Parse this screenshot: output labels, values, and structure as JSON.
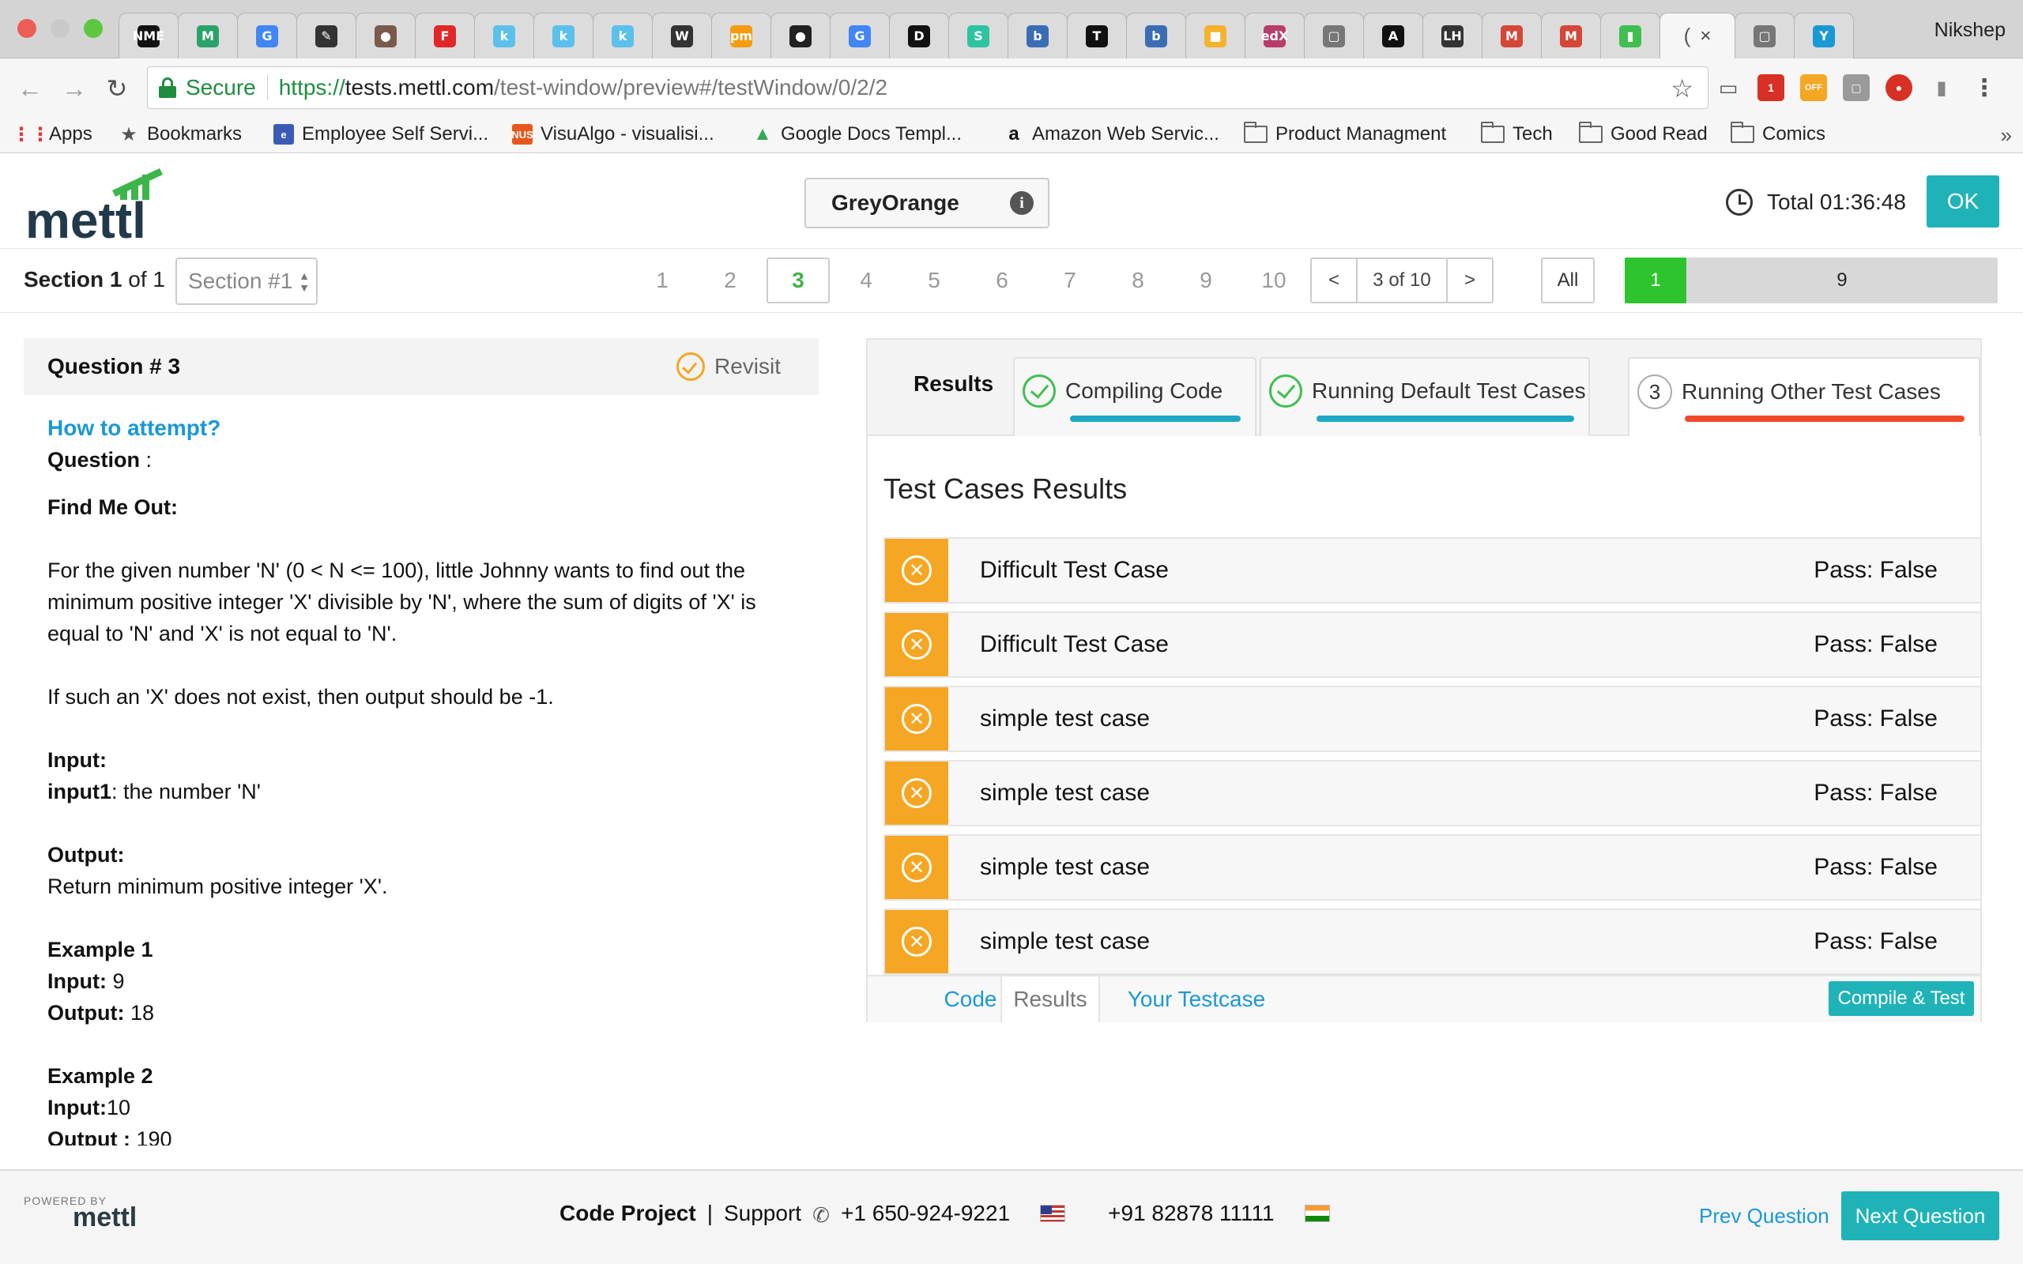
{
  "browser": {
    "profile_name": "Nikshep",
    "tabs": [
      {
        "icon": "nme-icon",
        "glyph": "NME",
        "color": "#111111"
      },
      {
        "icon": "m-logo-icon",
        "glyph": "M",
        "color": "#2aa36b"
      },
      {
        "icon": "google-icon",
        "glyph": "G",
        "color": "#4285f4"
      },
      {
        "icon": "pin-icon",
        "glyph": "✎",
        "color": "#333333"
      },
      {
        "icon": "avatar-icon",
        "glyph": "●",
        "color": "#7a5a4a"
      },
      {
        "icon": "flipboard-icon",
        "glyph": "F",
        "color": "#e12828"
      },
      {
        "icon": "k-icon",
        "glyph": "k",
        "color": "#5bc0eb"
      },
      {
        "icon": "k-icon",
        "glyph": "k",
        "color": "#5bc0eb"
      },
      {
        "icon": "k-icon",
        "glyph": "k",
        "color": "#5bc0eb"
      },
      {
        "icon": "wikipedia-icon",
        "glyph": "W",
        "color": "#333333"
      },
      {
        "icon": "pm-icon",
        "glyph": "pm",
        "color": "#f39c12"
      },
      {
        "icon": "github-icon",
        "glyph": "●",
        "color": "#222222"
      },
      {
        "icon": "google-icon",
        "glyph": "G",
        "color": "#4285f4"
      },
      {
        "icon": "d-icon",
        "glyph": "D",
        "color": "#111111"
      },
      {
        "icon": "s-icon",
        "glyph": "S",
        "color": "#2ec4a0"
      },
      {
        "icon": "b-icon",
        "glyph": "b",
        "color": "#3a6db4"
      },
      {
        "icon": "nyt-icon",
        "glyph": "T",
        "color": "#111111"
      },
      {
        "icon": "b-icon",
        "glyph": "b",
        "color": "#3a6db4"
      },
      {
        "icon": "box-icon",
        "glyph": "■",
        "color": "#f5b22d"
      },
      {
        "icon": "edx-icon",
        "glyph": "edX",
        "color": "#b83c6a"
      },
      {
        "icon": "document-icon",
        "glyph": "▢",
        "color": "#777777"
      },
      {
        "icon": "a-icon",
        "glyph": "A",
        "color": "#111111"
      },
      {
        "icon": "lh-icon",
        "glyph": "LH",
        "color": "#333333"
      },
      {
        "icon": "gmail-icon",
        "glyph": "M",
        "color": "#d44638"
      },
      {
        "icon": "gmail-icon",
        "glyph": "M",
        "color": "#d44638"
      },
      {
        "icon": "chart-icon",
        "glyph": "▮",
        "color": "#3fbf4f"
      }
    ],
    "active_tab_glyph": "(",
    "active_tab_close": "×",
    "trailing_tabs": [
      {
        "icon": "document-icon",
        "glyph": "▢",
        "color": "#777777"
      },
      {
        "icon": "y-icon",
        "glyph": "Y",
        "color": "#1a98d5"
      }
    ],
    "secure_label": "Secure",
    "url_scheme": "https://",
    "url_host": "tests.mettl.com",
    "url_path": "/test-window/preview#/testWindow/0/2/2",
    "bookmarks": [
      {
        "label": "Apps",
        "icon": "apps-icon"
      },
      {
        "label": "Bookmarks",
        "icon": "star-icon"
      },
      {
        "label": "Employee Self Servi...",
        "icon": "ess-icon"
      },
      {
        "label": "VisuAlgo - visualisi...",
        "icon": "nus-icon"
      },
      {
        "label": "Google Docs Templ...",
        "icon": "drive-icon"
      },
      {
        "label": "Amazon Web Servic...",
        "icon": "amazon-icon"
      },
      {
        "label": "Product Managment",
        "icon": "folder-icon"
      },
      {
        "label": "Tech",
        "icon": "folder-icon"
      },
      {
        "label": "Good Read",
        "icon": "folder-icon"
      },
      {
        "label": "Comics",
        "icon": "folder-icon"
      }
    ],
    "bookmarks_more": "»"
  },
  "header": {
    "logo_text": "mettl",
    "company": "GreyOrange",
    "timer_label": "Total 01:36:48",
    "ok_label": "OK"
  },
  "section_bar": {
    "section_word": "Section",
    "section_current": "1",
    "section_of": "of 1",
    "section_select": "Section #1",
    "questions": [
      "1",
      "2",
      "3",
      "4",
      "5",
      "6",
      "7",
      "8",
      "9",
      "10"
    ],
    "current_question": "3",
    "pager_prev": "<",
    "pager_text": "3 of 10",
    "pager_next": ">",
    "all_label": "All",
    "attempted_count": "1",
    "remaining_count": "9",
    "attempted_fraction": 0.1
  },
  "question": {
    "title": "Question # 3",
    "revisit_label": "Revisit",
    "how_to": "How to attempt?",
    "question_label": "Question",
    "question_colon": " :",
    "problem_title": "Find Me Out:",
    "para1": "For the given number 'N' (0 < N <= 100), little Johnny wants to find out the minimum positive integer 'X' divisible by 'N', where the sum of digits of 'X' is equal to 'N' and 'X' is not equal to 'N'.",
    "para2": "If such an 'X' does not exist, then output should be -1.",
    "input_label": "Input:",
    "input1_key": "input1",
    "input1_desc": ": the number 'N'",
    "output_label": "Output:",
    "output_desc": "Return minimum positive integer 'X'.",
    "ex1_title": "Example 1",
    "ex1_input_key": "Input:",
    "ex1_input_val": " 9",
    "ex1_output_key": "Output:",
    "ex1_output_val": " 18",
    "ex2_title": "Example 2",
    "ex2_input_key": "Input:",
    "ex2_input_val": "10",
    "ex2_output_key": "Output :",
    "ex2_output_val": " 190"
  },
  "results": {
    "tab_label": "Results",
    "stages": [
      {
        "label": "Compiling Code",
        "status": "done",
        "bar_color": "#1fa7c4"
      },
      {
        "label": "Running Default Test Cases",
        "status": "done",
        "bar_color": "#1fa7c4"
      },
      {
        "label": "Running Other Test Cases",
        "status": "3",
        "bar_color": "#f04a2b"
      }
    ],
    "heading": "Test Cases Results",
    "test_cases": [
      {
        "name": "Difficult Test Case",
        "result": "Pass: False"
      },
      {
        "name": "Difficult Test Case",
        "result": "Pass: False"
      },
      {
        "name": "simple test case",
        "result": "Pass: False"
      },
      {
        "name": "simple test case",
        "result": "Pass: False"
      },
      {
        "name": "simple test case",
        "result": "Pass: False"
      },
      {
        "name": "simple test case",
        "result": "Pass: False"
      }
    ],
    "footer_tabs": {
      "code": "Code",
      "results": "Results",
      "your_testcase": "Your Testcase"
    },
    "compile_label": "Compile & Test"
  },
  "footer": {
    "powered_by": "POWERED BY",
    "powered_logo": "mettl",
    "project": "Code Project",
    "separator": "|",
    "support": "Support",
    "phone_us": "+1 650-924-9221",
    "phone_in": "+91 82878 11111",
    "prev_label": "Prev Question",
    "next_label": "Next Question"
  },
  "colors": {
    "accent_teal": "#1fb3b8",
    "link_blue": "#1a98d5",
    "fail_orange": "#f5a623",
    "progress_green": "#2ec42e"
  }
}
